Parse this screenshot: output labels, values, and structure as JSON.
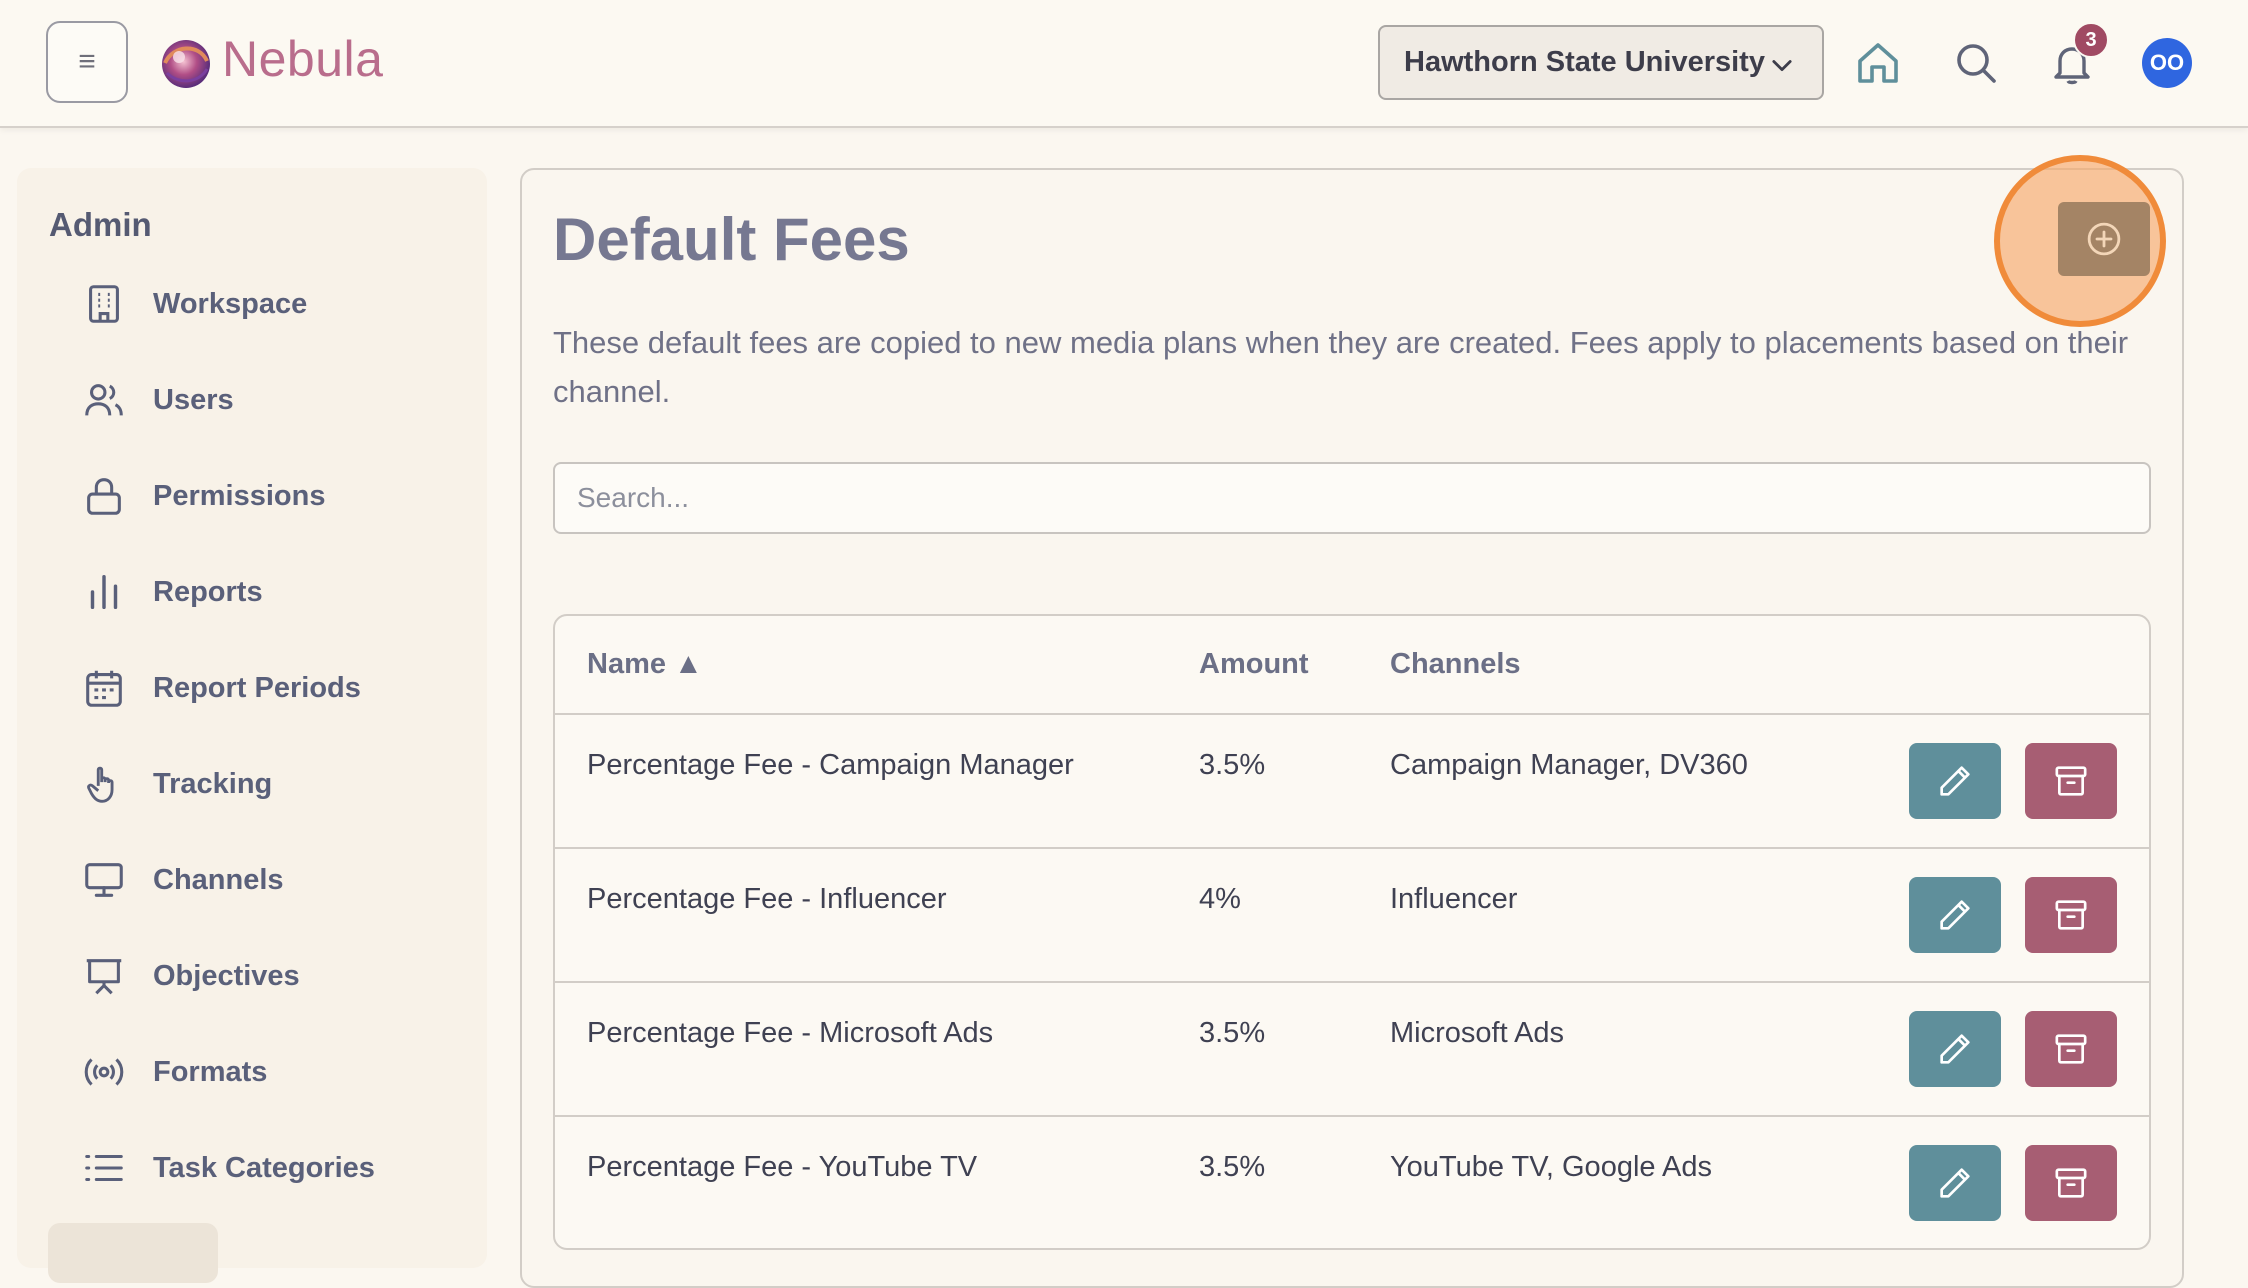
{
  "header": {
    "brand": "Nebula",
    "org_select": "Hawthorn State University",
    "notification_count": "3",
    "avatar_initials": "OO"
  },
  "sidebar": {
    "title": "Admin",
    "items": [
      {
        "label": "Workspace",
        "icon": "building-icon"
      },
      {
        "label": "Users",
        "icon": "users-icon"
      },
      {
        "label": "Permissions",
        "icon": "lock-icon"
      },
      {
        "label": "Reports",
        "icon": "bar-chart-icon"
      },
      {
        "label": "Report Periods",
        "icon": "calendar-icon"
      },
      {
        "label": "Tracking",
        "icon": "hand-pointer-icon"
      },
      {
        "label": "Channels",
        "icon": "monitor-icon"
      },
      {
        "label": "Objectives",
        "icon": "presentation-icon"
      },
      {
        "label": "Formats",
        "icon": "broadcast-icon"
      },
      {
        "label": "Task Categories",
        "icon": "list-icon"
      }
    ]
  },
  "main": {
    "title": "Default Fees",
    "description": "These default fees are copied to new media plans when they are created. Fees apply to placements based on their channel.",
    "search_placeholder": "Search...",
    "table": {
      "headers": {
        "name": "Name ▲",
        "amount": "Amount",
        "channels": "Channels"
      },
      "rows": [
        {
          "name": "Percentage Fee - Campaign Manager",
          "amount": "3.5%",
          "channels": "Campaign Manager, DV360"
        },
        {
          "name": "Percentage Fee - Influencer",
          "amount": "4%",
          "channels": "Influencer"
        },
        {
          "name": "Percentage Fee - Microsoft Ads",
          "amount": "3.5%",
          "channels": "Microsoft Ads"
        },
        {
          "name": "Percentage Fee - YouTube TV",
          "amount": "3.5%",
          "channels": "YouTube TV, Google Ads"
        }
      ]
    }
  },
  "colors": {
    "background": "#fbf7f0",
    "edit_button": "#5f8f9b",
    "delete_button": "#a75e73",
    "add_button": "#a48465",
    "highlight": "#f08b3a",
    "avatar": "#2f66e0"
  }
}
